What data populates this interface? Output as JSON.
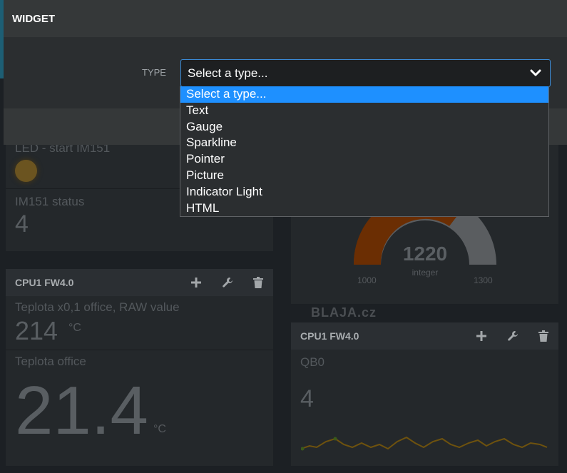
{
  "modal": {
    "title": "WIDGET",
    "type_label": "TYPE",
    "select_value": "Select a type..."
  },
  "dropdown": {
    "options": [
      "Select a type...",
      "Text",
      "Gauge",
      "Sparkline",
      "Pointer",
      "Picture",
      "Indicator Light",
      "HTML"
    ],
    "selected_index": 0
  },
  "dashboard": {
    "pane1": {
      "led_title": "LED - start IM151",
      "status_title": "IM151 status",
      "status_value": "4"
    },
    "pane2": {
      "header": "CPU1 FW4.0",
      "w1_title": "Teplota x0,1 office, RAW value",
      "w1_value": "214",
      "w1_unit": "°C",
      "w2_title": "Teplota office",
      "w2_value": "21.4",
      "w2_unit": "°C"
    },
    "gauge": {
      "value": "1220",
      "unit": "integer",
      "min": "1000",
      "max": "1300",
      "watermark": "BLAJA.cz"
    },
    "pane4": {
      "header": "CPU1 FW4.0",
      "title": "QB0",
      "value": "4"
    }
  },
  "colors": {
    "accent": "#1e90ff",
    "select_border": "#3b8bd6",
    "gauge_fill": "#7a3300",
    "sparkline": "#7a5a10"
  },
  "icons": [
    "plus-icon",
    "wrench-icon",
    "trash-icon",
    "chevron-down-icon"
  ]
}
